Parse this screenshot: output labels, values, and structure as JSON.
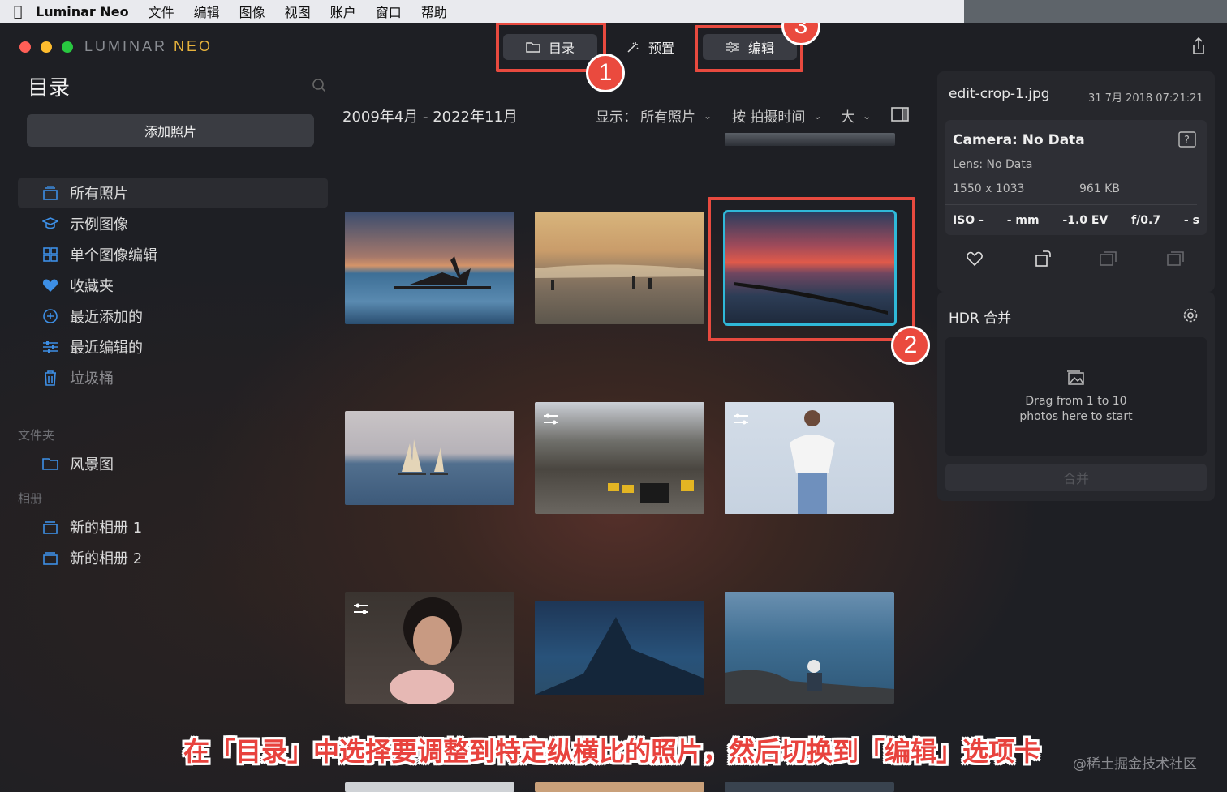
{
  "menubar": {
    "app_name": "Luminar Neo",
    "items": [
      "文件",
      "编辑",
      "图像",
      "视图",
      "账户",
      "窗口",
      "帮助"
    ]
  },
  "window": {
    "logo_part1": "LUMINAR",
    "logo_part2": "NEO",
    "tabs": [
      {
        "label": "目录",
        "icon": "folder-icon",
        "active": true
      },
      {
        "label": "预置",
        "icon": "sparkle-icon",
        "active": false
      },
      {
        "label": "编辑",
        "icon": "sliders-icon",
        "active": true
      }
    ],
    "badges": [
      "1",
      "2",
      "3"
    ]
  },
  "sidebar": {
    "title": "目录",
    "add_button": "添加照片",
    "items": [
      {
        "label": "所有照片",
        "icon": "stack-icon",
        "selected": true
      },
      {
        "label": "示例图像",
        "icon": "graduation-cap-icon"
      },
      {
        "label": "单个图像编辑",
        "icon": "grid-icon"
      },
      {
        "label": "收藏夹",
        "icon": "heart-icon"
      },
      {
        "label": "最近添加的",
        "icon": "plus-circle-icon"
      },
      {
        "label": "最近编辑的",
        "icon": "sliders-icon"
      },
      {
        "label": "垃圾桶",
        "icon": "trash-icon"
      }
    ],
    "folders_label": "文件夹",
    "folders": [
      {
        "label": "风景图",
        "icon": "folder-icon"
      }
    ],
    "albums_label": "相册",
    "albums": [
      {
        "label": "新的相册 1",
        "icon": "album-icon"
      },
      {
        "label": "新的相册 2",
        "icon": "album-icon"
      }
    ]
  },
  "grid": {
    "date_range": "2009年4月 - 2022年11月",
    "show_label": "显示：",
    "show_value": "所有照片",
    "sort_value": "按 拍摄时间",
    "size_value": "大"
  },
  "photos": [
    {
      "name": "driftwood-sunset",
      "adjusted": false
    },
    {
      "name": "beach-people",
      "adjusted": false
    },
    {
      "name": "pier-sunset-selected",
      "adjusted": false,
      "selected": true
    },
    {
      "name": "sailboats",
      "adjusted": false
    },
    {
      "name": "city-taxis",
      "adjusted": true
    },
    {
      "name": "woman-white-top",
      "adjusted": true
    },
    {
      "name": "woman-portrait",
      "adjusted": true
    },
    {
      "name": "mountain-stars",
      "adjusted": false
    },
    {
      "name": "coast-person",
      "adjusted": false
    }
  ],
  "info_panel": {
    "filename": "edit-crop-1.jpg",
    "date": "31 7月 2018 07:21:21",
    "camera": "Camera: No Data",
    "lens": "Lens: No Data",
    "dimensions": "1550 x 1033",
    "filesize": "961 KB",
    "iso": "ISO -",
    "focal": "- mm",
    "ev": "-1.0 EV",
    "aperture": "f/0.7",
    "shutter": "- s"
  },
  "hdr_panel": {
    "title": "HDR 合并",
    "drop_line1": "Drag from 1 to 10",
    "drop_line2": "photos here to start",
    "merge_button": "合并"
  },
  "caption": "在「目录」中选择要调整到特定纵横比的照片，然后切换到「编辑」选项卡",
  "watermark": "@稀土掘金技术社区"
}
